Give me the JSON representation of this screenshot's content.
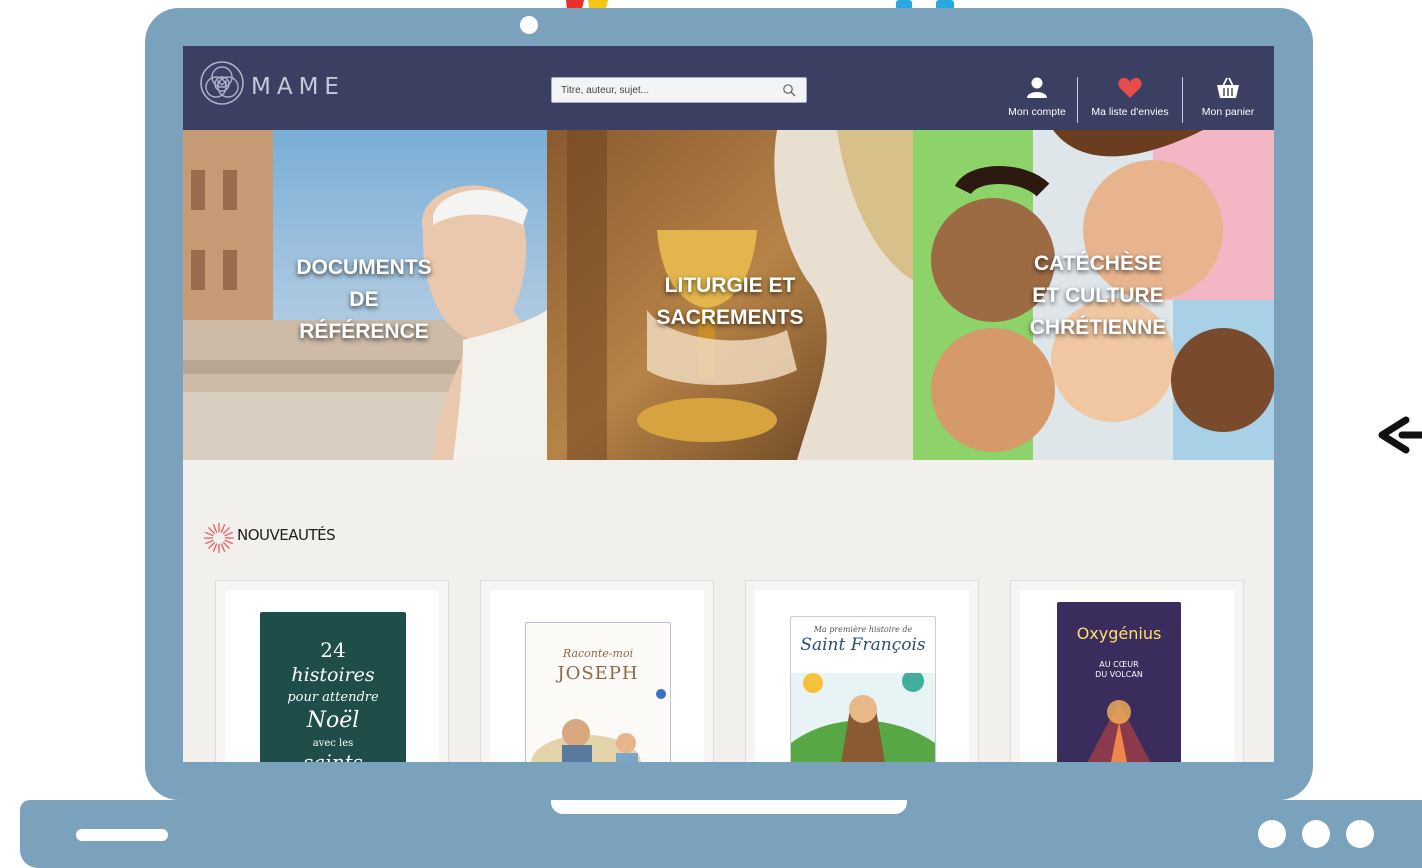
{
  "colors": {
    "frame": "#7aa2bc",
    "header_bg": "#3b4062",
    "heart": "#e84c4c",
    "section_bg": "#f1f0ed",
    "news_icon": "#ea5a5a"
  },
  "header": {
    "logo_text": "MAME",
    "search": {
      "placeholder": "Titre, auteur, sujet..."
    },
    "nav": [
      {
        "label": "Mon compte",
        "icon": "user-icon"
      },
      {
        "label": "Ma liste d'envies",
        "icon": "heart-icon"
      },
      {
        "label": "Mon panier",
        "icon": "basket-icon"
      }
    ]
  },
  "hero": {
    "panels": [
      {
        "title": "DOCUMENTS\nDE\nRÉFÉRENCE"
      },
      {
        "title": "LITURGIE ET\nSACREMENTS"
      },
      {
        "title": "CATÉCHÈSE\nET CULTURE\nCHRÉTIENNE"
      }
    ]
  },
  "news": {
    "title": "NOUVEAUTÉS",
    "books": [
      {
        "cover_lines": [
          "24",
          "histoires",
          "pour attendre",
          "Noël",
          "avec les",
          "saints"
        ]
      },
      {
        "cover_lines": [
          "Raconte-moi",
          "JOSEPH"
        ]
      },
      {
        "cover_lines": [
          "Ma première histoire de",
          "Saint François"
        ]
      },
      {
        "cover_lines": [
          "Oxygénius",
          "AU CŒUR",
          "DU VOLCAN"
        ]
      }
    ]
  }
}
